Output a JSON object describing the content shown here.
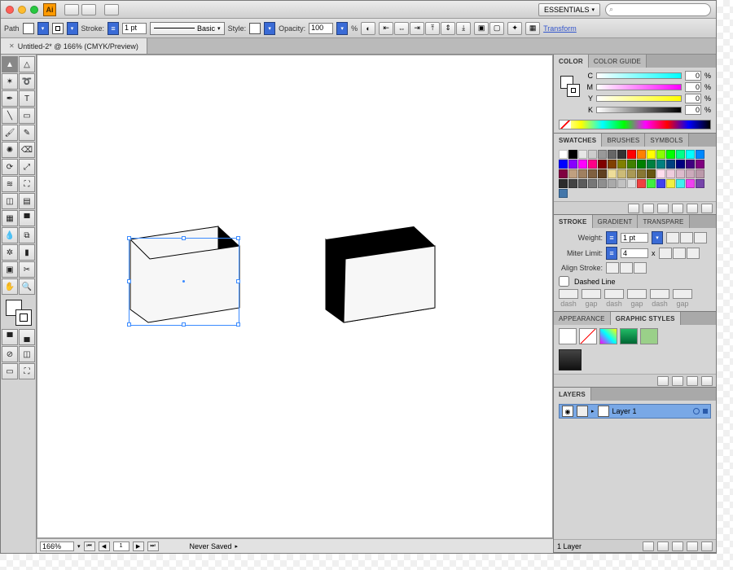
{
  "titlebar": {
    "workspace_label": "ESSENTIALS",
    "search_placeholder": "⌕"
  },
  "controlbar": {
    "sel_label": "Path",
    "stroke_label": "Stroke:",
    "stroke_weight": "1 pt",
    "brush_label": "Basic",
    "style_label": "Style:",
    "opacity_label": "Opacity:",
    "opacity_value": "100",
    "pct": "%",
    "transform_label": "Transform"
  },
  "doc": {
    "tab_label": "Untitled-2* @ 166% (CMYK/Preview)"
  },
  "status": {
    "zoom": "166%",
    "page": "1",
    "save_state": "Never Saved"
  },
  "panels": {
    "color": {
      "tab1": "Color",
      "tab2": "Color Guide",
      "c_label": "C",
      "m_label": "M",
      "y_label": "Y",
      "k_label": "K",
      "c_val": "0",
      "m_val": "0",
      "y_val": "0",
      "k_val": "0",
      "pct": "%"
    },
    "swatches": {
      "tab1": "Swatches",
      "tab2": "Brushes",
      "tab3": "Symbols"
    },
    "stroke": {
      "tab1": "Stroke",
      "tab2": "Gradient",
      "tab3": "Transpare",
      "weight_label": "Weight:",
      "weight_val": "1 pt",
      "miter_label": "Miter Limit:",
      "miter_val": "4",
      "miter_x": "x",
      "align_label": "Align Stroke:",
      "dashed_label": "Dashed Line",
      "dash_labels": [
        "dash",
        "gap",
        "dash",
        "gap",
        "dash",
        "gap"
      ]
    },
    "styles": {
      "tab1": "Appearance",
      "tab2": "Graphic Styles"
    },
    "layers": {
      "tab1": "Layers",
      "layer1": "Layer 1",
      "count": "1 Layer"
    }
  }
}
